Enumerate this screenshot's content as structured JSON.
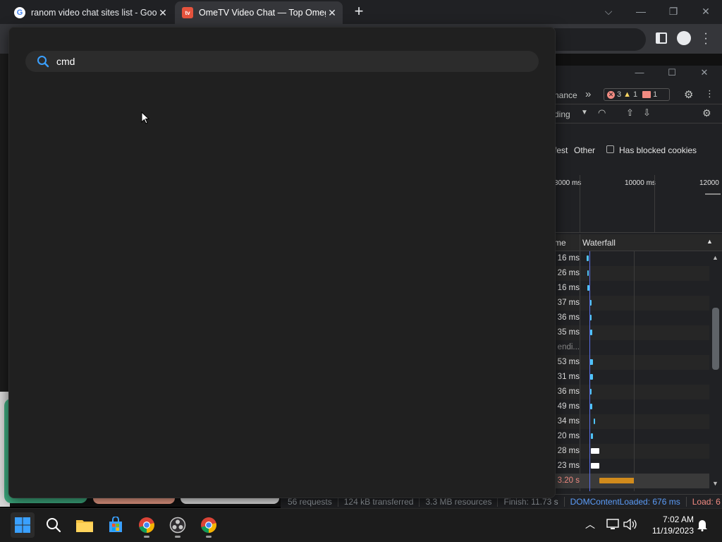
{
  "browser": {
    "tabs": [
      {
        "title": "ranom video chat sites list - Goo",
        "favicon": "google-icon",
        "close": "✕"
      },
      {
        "title": "OmeTV Video Chat — Top Omeg",
        "favicon": "ometv-icon",
        "close": "✕"
      }
    ],
    "new_tab": "+",
    "window_controls": {
      "dropdown": "⌵",
      "minimize": "—",
      "maximize": "❐",
      "close": "✕"
    }
  },
  "palette": {
    "search_value": "cmd",
    "search_icon": "search-icon"
  },
  "devtools": {
    "tabs_visible": "nance",
    "more": "»",
    "errors": "3",
    "warnings": "1",
    "issues": "1",
    "throttle_visible": "ding",
    "filter_partial": "fest",
    "filter_other": "Other",
    "blocked_cookies": "Has blocked cookies",
    "overview_ticks": [
      "3000 ms",
      "10000 ms",
      "12000"
    ],
    "col_time": "me",
    "col_waterfall": "Waterfall",
    "rows": [
      "16 ms",
      "26 ms",
      "16 ms",
      "37 ms",
      "36 ms",
      "35 ms",
      "endi...",
      "53 ms",
      "31 ms",
      "36 ms",
      "49 ms",
      "34 ms",
      "20 ms",
      "28 ms",
      "23 ms",
      "3.20 s"
    ],
    "status": {
      "requests": "56 requests",
      "transferred": "124 kB transferred",
      "resources": "3.3 MB resources",
      "finish": "Finish: 11.73 s",
      "dcl": "DOMContentLoaded: 676 ms",
      "load": "Load: 6"
    }
  },
  "taskbar": {
    "time": "7:02 AM",
    "date": "11/19/2023",
    "icons": [
      "windows-start-icon",
      "search-icon",
      "file-explorer-icon",
      "microsoft-store-icon",
      "chrome-icon",
      "obs-icon",
      "chrome-icon"
    ]
  },
  "colors": {
    "accent": "#1a73e8",
    "error": "#f28b82",
    "warning": "#fdd663",
    "dcl": "#5b9cf8",
    "load": "#f28b82"
  }
}
